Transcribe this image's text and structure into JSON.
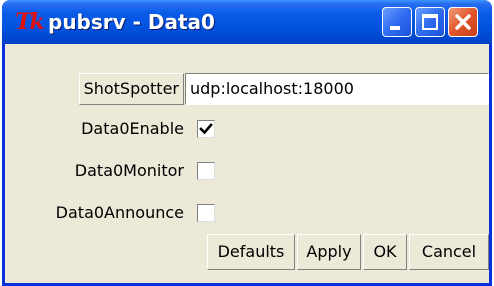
{
  "window": {
    "title": "pubsrv - Data0",
    "app_icon_text": "Tk",
    "controls": [
      "minimize-icon",
      "maximize-icon",
      "close-icon"
    ]
  },
  "fields": {
    "shotspotter": {
      "label": "ShotSpotter",
      "value": "udp:localhost:18000"
    },
    "data0_enable": {
      "label": "Data0Enable",
      "checked": true
    },
    "data0_monitor": {
      "label": "Data0Monitor",
      "checked": false
    },
    "data0_announce": {
      "label": "Data0Announce",
      "checked": false
    }
  },
  "buttons": {
    "defaults": "Defaults",
    "apply": "Apply",
    "ok": "OK",
    "cancel": "Cancel"
  },
  "colors": {
    "titlebar": "#0254e0",
    "window_bg": "#ece9d8",
    "close_button": "#e0562a"
  }
}
